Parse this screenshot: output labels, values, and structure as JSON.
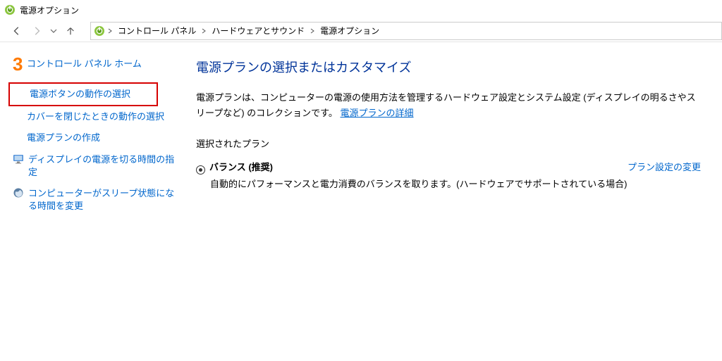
{
  "window": {
    "title": "電源オプション"
  },
  "breadcrumb": {
    "items": [
      "コントロール パネル",
      "ハードウェアとサウンド",
      "電源オプション"
    ]
  },
  "sidebar": {
    "home": "コントロール パネル ホーム",
    "items": [
      {
        "label": "電源ボタンの動作の選択",
        "highlighted": true
      },
      {
        "label": "カバーを閉じたときの動作の選択"
      },
      {
        "label": "電源プランの作成"
      },
      {
        "label": "ディスプレイの電源を切る時間の指定",
        "icon": "display"
      },
      {
        "label": "コンピューターがスリープ状態になる時間を変更",
        "icon": "sleep"
      }
    ]
  },
  "main": {
    "heading": "電源プランの選択またはカスタマイズ",
    "description_pre": "電源プランは、コンピューターの電源の使用方法を管理するハードウェア設定とシステム設定 (ディスプレイの明るさやスリープなど) のコレクションです。",
    "description_link": "電源プランの詳細",
    "selected_plan_label": "選択されたプラン",
    "plan": {
      "name": "バランス (推奨)",
      "change": "プラン設定の変更",
      "desc": "自動的にパフォーマンスと電力消費のバランスを取ります。(ハードウェアでサポートされている場合)"
    }
  },
  "annotation": {
    "step": "3"
  }
}
